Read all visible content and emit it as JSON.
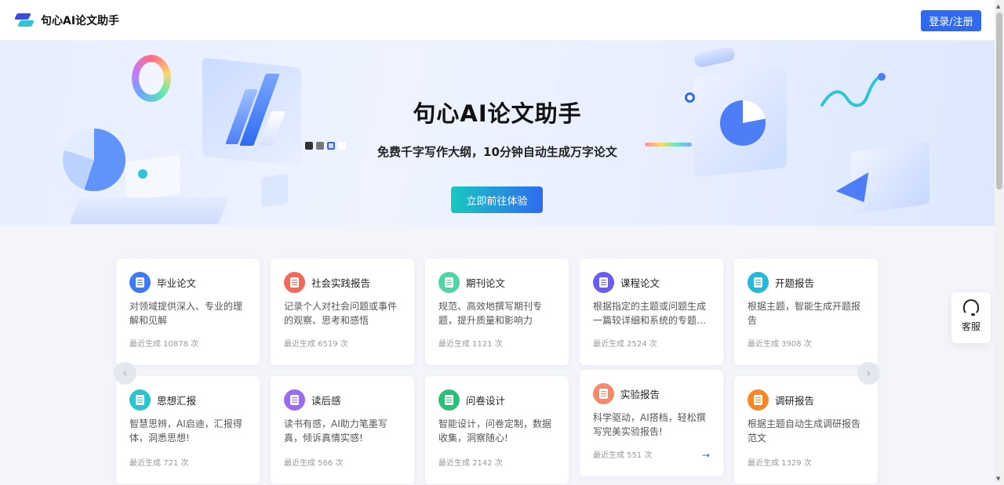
{
  "header": {
    "brand": "句心AI论文助手",
    "login_label": "登录/注册"
  },
  "hero": {
    "title": "句心AI论文助手",
    "subtitle": "免费千字写作大纲，10分钟自动生成万字论文",
    "cta_label": "立即前往体验"
  },
  "colors": {
    "primary": "#2f6bf2",
    "cta_gradient_start": "#18c8c0",
    "cta_gradient_end": "#2f6bf2"
  },
  "cards": [
    {
      "title": "毕业论文",
      "desc": "对领域提供深入、专业的理解和见解",
      "count": "最近生成 10878 次",
      "icon": "document-icon",
      "color": "#3d7cf4"
    },
    {
      "title": "社会实践报告",
      "desc": "记录个人对社会问题或事件的观察、思考和感悟",
      "count": "最近生成 6519 次",
      "icon": "report-icon",
      "color": "#f26a5a"
    },
    {
      "title": "期刊论文",
      "desc": "规范、高效地撰写期刊专题，提升质量和影响力",
      "count": "最近生成 1121 次",
      "icon": "journal-icon",
      "color": "#4fd6a6"
    },
    {
      "title": "课程论文",
      "desc": "根据指定的主题或问题生成一篇较详细和系统的专题…",
      "count": "最近生成 2524 次",
      "icon": "course-icon",
      "color": "#6a5cf0"
    },
    {
      "title": "开题报告",
      "desc": "根据主题，智能生成开题报告",
      "count": "最近生成 3908 次",
      "icon": "book-icon",
      "color": "#26b8d8"
    },
    {
      "title": "思想汇报",
      "desc": "智慧思辨，AI启迪，汇报得体，洞悉思想!",
      "count": "最近生成 721 次",
      "icon": "thought-icon",
      "color": "#2cc3d0"
    },
    {
      "title": "读后感",
      "desc": "读书有感，AI助力笔墨写真，倾诉真情实感!",
      "count": "最近生成 566 次",
      "icon": "reading-icon",
      "color": "#9a6af0"
    },
    {
      "title": "问卷设计",
      "desc": "智能设计，问卷定制，数据收集，洞察随心!",
      "count": "最近生成 2142 次",
      "icon": "survey-icon",
      "color": "#2bbf7a"
    },
    {
      "title": "实验报告",
      "desc": "科学驱动，AI搭档，轻松撰写完美实验报告!",
      "count": "最近生成 551 次",
      "icon": "flask-icon",
      "color": "#f48a6a"
    },
    {
      "title": "调研报告",
      "desc": "根据主题自动生成调研报告范文",
      "count": "最近生成 1329 次",
      "icon": "location-icon",
      "color": "#f5892a"
    }
  ],
  "carousel": {
    "prev_icon": "chevron-left-icon",
    "next_icon": "chevron-right-icon"
  },
  "service": {
    "label": "客服",
    "icon": "headset-icon"
  }
}
